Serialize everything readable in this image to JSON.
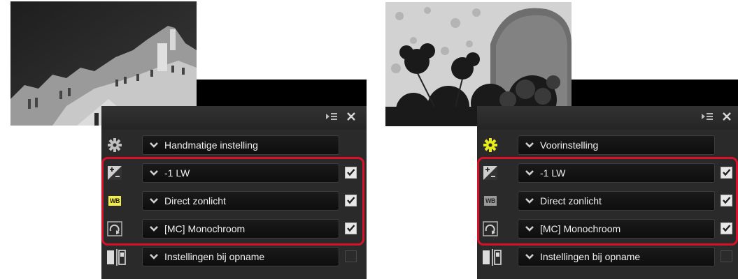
{
  "panels": [
    {
      "id": "left",
      "header": {
        "collapse_icon": "panel-menu-icon",
        "close_icon": "close-icon"
      },
      "picture_control": {
        "icon": "gear-icon",
        "icon_color": "#bfbfbf",
        "value": "Handmatige instelling"
      },
      "exposure": {
        "icon": "exposure-compensation-icon",
        "value": "-1 LW",
        "checked": true
      },
      "white_balance": {
        "icon": "wb-icon",
        "badge": "WB",
        "badge_bg": "#f2ec43",
        "badge_fg": "#222222",
        "value": "Direct zonlicht",
        "checked": true
      },
      "picture_style": {
        "icon": "picture-control-icon",
        "value": "[MC] Monochroom",
        "checked": true
      },
      "capture": {
        "icon": "capture-settings-icon",
        "value": "Instellingen bij opname",
        "checked": false
      }
    },
    {
      "id": "right",
      "header": {
        "collapse_icon": "panel-menu-icon",
        "close_icon": "close-icon"
      },
      "picture_control": {
        "icon": "gear-icon",
        "icon_color": "#e7ec1a",
        "value": "Voorinstelling"
      },
      "exposure": {
        "icon": "exposure-compensation-icon",
        "value": "-1 LW",
        "checked": true
      },
      "white_balance": {
        "icon": "wb-icon",
        "badge": "WB",
        "badge_bg": "#9a9a9a",
        "badge_fg": "#2a2a2a",
        "value": "Direct zonlicht",
        "checked": true
      },
      "picture_style": {
        "icon": "picture-control-icon",
        "value": "[MC] Monochroom",
        "checked": true
      },
      "capture": {
        "icon": "capture-settings-icon",
        "value": "Instellingen bij opname",
        "checked": false
      }
    }
  ],
  "colors": {
    "highlight": "#d6132b",
    "panel_bg": "#2a2a2a"
  },
  "thumbnails": [
    {
      "id": "left",
      "subject": "monochrome building photo"
    },
    {
      "id": "right",
      "subject": "monochrome flowers and stone photo"
    }
  ]
}
